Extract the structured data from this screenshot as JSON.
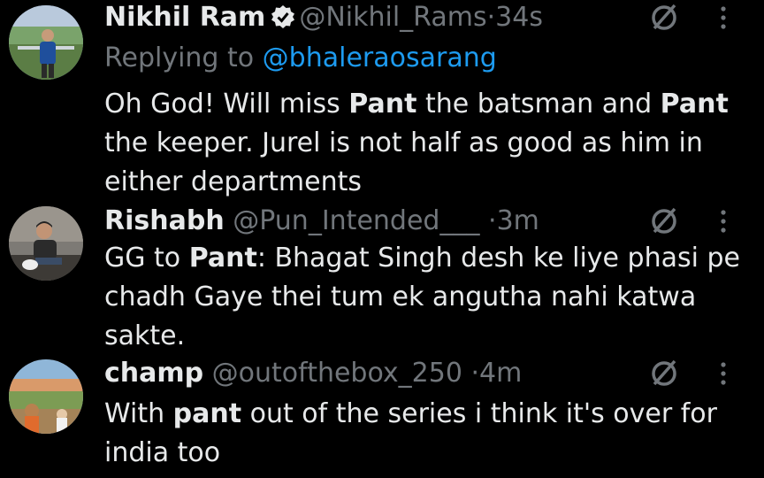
{
  "tweets": [
    {
      "name": "Nikhil Ram",
      "handle": "@Nikhil_Rams",
      "separator": "·",
      "time": "34s",
      "verified": true,
      "replying_prefix": "Replying to ",
      "replying_to": "@bhaleraosarang",
      "text_parts": [
        {
          "t": "Oh God! Will miss ",
          "bold": false
        },
        {
          "t": "Pant",
          "bold": true
        },
        {
          "t": " the batsman and ",
          "bold": false
        },
        {
          "t": "Pant",
          "bold": true
        },
        {
          "t": " the keeper. Jurel is not half as good as him in either departments",
          "bold": false
        }
      ]
    },
    {
      "name": "Rishabh",
      "handle": "@Pun_Intended___",
      "separator": "·",
      "time": "3m",
      "verified": false,
      "text_parts": [
        {
          "t": "GG to ",
          "bold": false
        },
        {
          "t": "Pant",
          "bold": true
        },
        {
          "t": ": Bhagat Singh desh ke liye phasi pe chadh Gaye thei tum ek angutha nahi katwa sakte.",
          "bold": false
        }
      ]
    },
    {
      "name": "champ",
      "handle": "@outofthebox_250",
      "separator": "·",
      "time": "4m",
      "verified": false,
      "text_parts": [
        {
          "t": "With ",
          "bold": false
        },
        {
          "t": "pant",
          "bold": true
        },
        {
          "t": " out of the series i think it's over for india too",
          "bold": false
        }
      ]
    }
  ],
  "icons": {
    "verified": "verified-badge-icon",
    "grok": "slashed-circle-icon",
    "more": "more-vertical-icon"
  },
  "colors": {
    "background": "#000000",
    "primary_text": "#e7e9ea",
    "secondary_text": "#71767b",
    "link": "#1d9bf0"
  }
}
